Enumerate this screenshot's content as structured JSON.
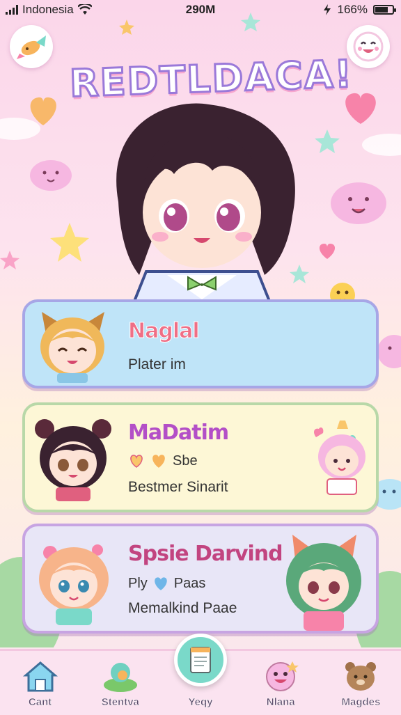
{
  "status_bar": {
    "carrier": "Indonesia",
    "time": "290M",
    "battery": "166%"
  },
  "header": {
    "title": "REDTLDACA!",
    "left_button_icon": "candy-fish-icon",
    "right_button_icon": "smiley-face-icon"
  },
  "characters": [
    {
      "name": "Naglal",
      "subtitle": "Plater im",
      "avatar_icon": "cat-ear-girl-icon"
    },
    {
      "name": "MaDatim",
      "tag_text": "Sbe",
      "subtitle": "Bestmer Sinarit",
      "avatar_icon": "bear-ear-girl-icon"
    },
    {
      "name": "Spsie Darvind",
      "tag_text": "Ply",
      "tag_text_2": "Paas",
      "subtitle": "Memalkind Paae",
      "avatar_icon": "flower-girl-icon"
    }
  ],
  "nav": {
    "items": [
      {
        "label": "Cant",
        "icon": "house-icon"
      },
      {
        "label": "Stentva",
        "icon": "park-icon"
      },
      {
        "label": "Yeqy",
        "icon": "notepad-icon"
      },
      {
        "label": "Nlana",
        "icon": "smiley-icon"
      },
      {
        "label": "Magdes",
        "icon": "bear-icon"
      }
    ]
  },
  "colors": {
    "background_pink": "#fbd6ea",
    "card_blue": "#bfe4f8",
    "card_yellow": "#fdf7d6",
    "card_lavender": "#e8e6f7",
    "accent_teal": "#7ad9c9"
  }
}
